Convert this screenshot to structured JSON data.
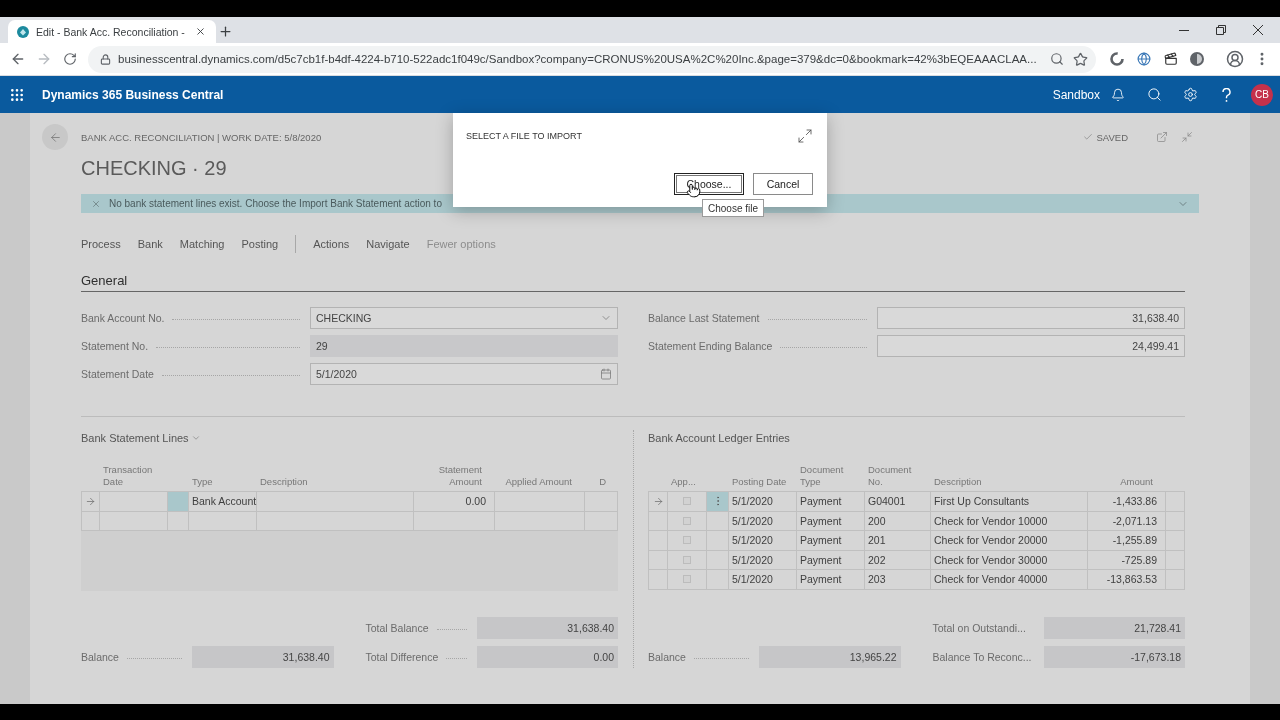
{
  "browser": {
    "tab_title": "Edit - Bank Acc. Reconciliation -",
    "url": "businesscentral.dynamics.com/d5c7cb1f-b4df-4224-b710-522adc1f049c/Sandbox?company=CRONUS%20USA%2C%20Inc.&page=379&dc=0&bookmark=42%3bEQEAAACLAA..."
  },
  "app_bar": {
    "title": "Dynamics 365 Business Central",
    "environment": "Sandbox",
    "user_initials": "CB"
  },
  "page": {
    "breadcrumb": "BANK ACC. RECONCILIATION | WORK DATE: 5/8/2020",
    "save_status": "SAVED",
    "title": "CHECKING · 29",
    "notification": "No bank statement lines exist. Choose the Import Bank Statement action to",
    "action_groups": [
      [
        {
          "label": "Process",
          "kind": "menu"
        },
        {
          "label": "Bank",
          "kind": "menu"
        },
        {
          "label": "Matching",
          "kind": "menu"
        },
        {
          "label": "Posting",
          "kind": "menu"
        }
      ],
      [
        {
          "label": "Actions",
          "kind": "menu"
        },
        {
          "label": "Navigate",
          "kind": "menu"
        },
        {
          "label": "Fewer options",
          "kind": "toggle"
        }
      ]
    ],
    "general": {
      "title": "General",
      "left_fields": [
        {
          "label": "Bank Account No.",
          "value": "CHECKING",
          "kind": "dropdown",
          "disabled": false
        },
        {
          "label": "Statement No.",
          "value": "29",
          "kind": "text",
          "disabled": true
        },
        {
          "label": "Statement Date",
          "value": "5/1/2020",
          "kind": "date",
          "disabled": false
        }
      ],
      "right_fields": [
        {
          "label": "Balance Last Statement",
          "value": "31,638.40",
          "kind": "amount",
          "disabled": false
        },
        {
          "label": "Statement Ending Balance",
          "value": "24,499.41",
          "kind": "amount",
          "disabled": false
        }
      ]
    },
    "bank_statement_lines": {
      "title": "Bank Statement Lines",
      "columns": [
        "Transaction Date",
        "Type",
        "Description",
        "Statement Amount",
        "Applied Amount",
        "D"
      ],
      "rows": [
        {
          "current": true,
          "type": "Bank Account",
          "statement_amount": "0.00"
        },
        {
          "current": false
        }
      ],
      "balance": {
        "label": "Balance",
        "value": "31,638.40"
      },
      "totals": [
        {
          "label": "Total Balance",
          "value": "31,638.40"
        },
        {
          "label": "Total Difference",
          "value": "0.00"
        }
      ]
    },
    "ledger_entries": {
      "title": "Bank Account Ledger Entries",
      "columns": [
        "App...",
        "Posting Date",
        "Document Type",
        "Document No.",
        "Description",
        "Amount"
      ],
      "rows": [
        {
          "current": true,
          "applied": false,
          "posting_date": "5/1/2020",
          "document_type": "Payment",
          "document_no": "G04001",
          "description": "First Up Consultants",
          "amount": "-1,433.86"
        },
        {
          "current": false,
          "applied": false,
          "posting_date": "5/1/2020",
          "document_type": "Payment",
          "document_no": "200",
          "description": "Check for Vendor 10000",
          "amount": "-2,071.13"
        },
        {
          "current": false,
          "applied": false,
          "posting_date": "5/1/2020",
          "document_type": "Payment",
          "document_no": "201",
          "description": "Check for Vendor 20000",
          "amount": "-1,255.89"
        },
        {
          "current": false,
          "applied": false,
          "posting_date": "5/1/2020",
          "document_type": "Payment",
          "document_no": "202",
          "description": "Check for Vendor 30000",
          "amount": "-725.89"
        },
        {
          "current": false,
          "applied": false,
          "posting_date": "5/1/2020",
          "document_type": "Payment",
          "document_no": "203",
          "description": "Check for Vendor 40000",
          "amount": "-13,863.53"
        }
      ],
      "balance": {
        "label": "Balance",
        "value": "13,965.22"
      },
      "totals": [
        {
          "label": "Total on Outstandi...",
          "value": "21,728.41"
        },
        {
          "label": "Balance To Reconc...",
          "value": "-17,673.18"
        }
      ]
    }
  },
  "dialog": {
    "title": "SELECT A FILE TO IMPORT",
    "buttons": [
      {
        "label": "Choose...",
        "focused": true
      },
      {
        "label": "Cancel",
        "focused": false
      }
    ],
    "tooltip": "Choose file"
  }
}
